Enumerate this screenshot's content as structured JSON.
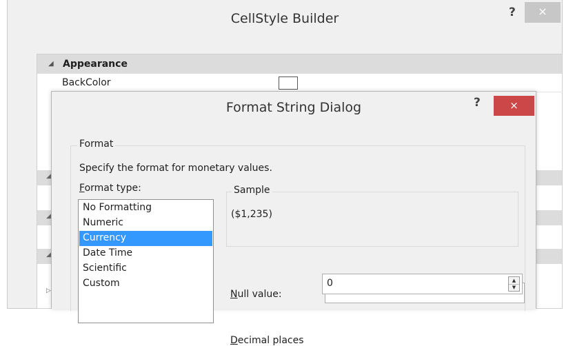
{
  "outer_dialog": {
    "title": "CellStyle Builder",
    "help_label": "?",
    "close_label": "×"
  },
  "property_grid": {
    "category": "Appearance",
    "row_label": "BackColor",
    "backcolor_value": "#ffffff"
  },
  "inner_dialog": {
    "title": "Format String Dialog",
    "help_label": "?",
    "close_label": "×",
    "group_label": "Format",
    "description": "Specify the format for monetary values.",
    "format_type_label_accel": "F",
    "format_type_label_rest": "ormat type:",
    "format_types": [
      "No Formatting",
      "Numeric",
      "Currency",
      "Date Time",
      "Scientific",
      "Custom"
    ],
    "selected_format": "Currency",
    "sample_label": "Sample",
    "sample_value": "($1,235)",
    "null_value_label_accel": "N",
    "null_value_label_rest": "ull value:",
    "null_value": "",
    "decimal_places_label_accel": "D",
    "decimal_places_label_rest": "ecimal places",
    "decimal_places_value": "0"
  },
  "colors": {
    "selection": "#3399ff",
    "close_button_active": "#cc4747",
    "close_button_inactive": "#c7c7c7"
  }
}
